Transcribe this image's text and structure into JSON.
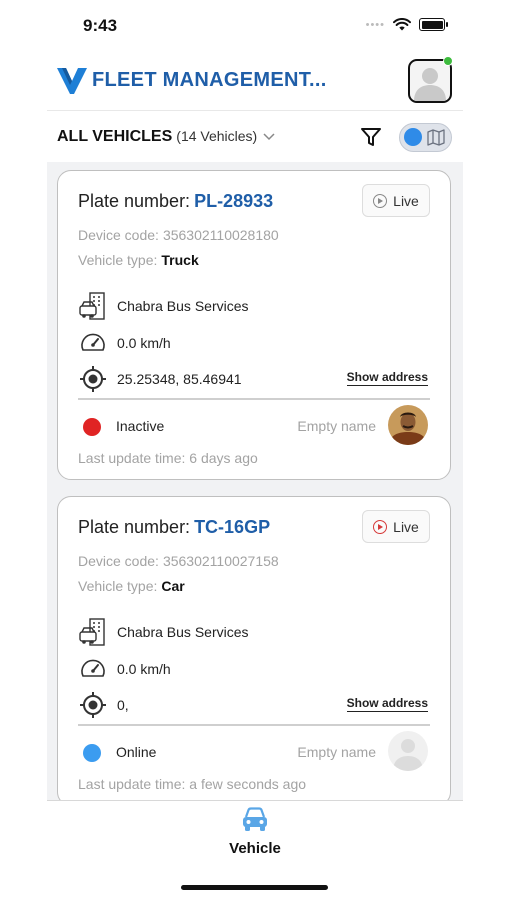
{
  "status_bar": {
    "time": "9:43"
  },
  "header": {
    "title": "FLEET MANAGEMENT..."
  },
  "filter": {
    "label": "ALL VEHICLES",
    "count": "(14 Vehicles)"
  },
  "vehicles": [
    {
      "plate_label": "Plate number:",
      "plate": "PL-28933",
      "live_label": "Live",
      "device_label": "Device code:",
      "device_code": "356302110028180",
      "type_label": "Vehicle type:",
      "type": "Truck",
      "company": "Chabra Bus Services",
      "speed": "0.0 km/h",
      "coordinates": "25.25348, 85.46941",
      "show_address": "Show address",
      "status": "Inactive",
      "status_color": "#e02424",
      "driver": "Empty name",
      "last_update": "Last update time: 6 days ago"
    },
    {
      "plate_label": "Plate number:",
      "plate": "TC-16GP",
      "live_label": "Live",
      "device_label": "Device code:",
      "device_code": "356302110027158",
      "type_label": "Vehicle type:",
      "type": "Car",
      "company": "Chabra Bus Services",
      "speed": "0.0 km/h",
      "coordinates": "0,",
      "show_address": "Show address",
      "status": "Online",
      "status_color": "#3b9cf0",
      "driver": "Empty name",
      "last_update": "Last update time: a few seconds ago"
    }
  ],
  "tabs": [
    {
      "label": "Vehicle",
      "icon": "car-icon"
    }
  ],
  "colors": {
    "brand": "#1f5ea8",
    "accent": "#2f8be8",
    "tab_icon": "#5aa6e6"
  }
}
